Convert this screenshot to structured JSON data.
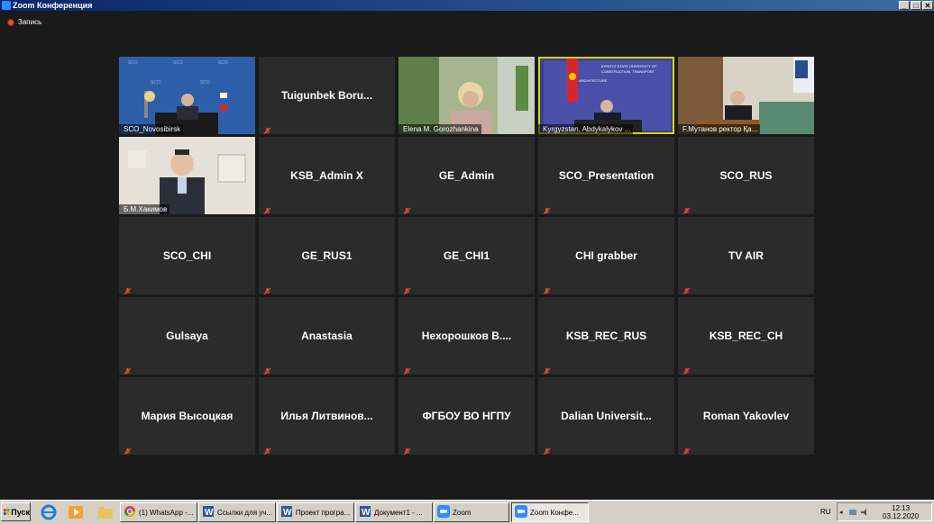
{
  "window": {
    "title": "Zoom Конференция",
    "minimize": "_",
    "maximize": "□",
    "close": "✕"
  },
  "recording": {
    "label": "Запись"
  },
  "tiles": [
    {
      "name": "SCO_Novosibirsk",
      "video": true,
      "kind": "novosibirsk"
    },
    {
      "name": "Tuigunbek Boru...",
      "video": false
    },
    {
      "name": "Elena M. Gorozhankina",
      "video": true,
      "kind": "elena"
    },
    {
      "name": "Kyrgyzstan, Abdykalykov ...",
      "video": true,
      "kind": "kyrgyz",
      "active": true
    },
    {
      "name": "F.Мутанов ректор Қа...",
      "video": true,
      "kind": "mutanov"
    },
    {
      "name": "Б.М.Хакимов",
      "video": true,
      "kind": "hakimov"
    },
    {
      "name": "KSB_Admin X",
      "video": false
    },
    {
      "name": "GE_Admin",
      "video": false
    },
    {
      "name": "SCO_Presentation",
      "video": false
    },
    {
      "name": "SCO_RUS",
      "video": false
    },
    {
      "name": "SCO_CHI",
      "video": false
    },
    {
      "name": "GE_RUS1",
      "video": false
    },
    {
      "name": "GE_CHI1",
      "video": false
    },
    {
      "name": "CHI grabber",
      "video": false
    },
    {
      "name": "TV AIR",
      "video": false
    },
    {
      "name": "Gulsaya",
      "video": false
    },
    {
      "name": "Anastasia",
      "video": false
    },
    {
      "name": "Нехорошков В....",
      "video": false
    },
    {
      "name": "KSB_REC_RUS",
      "video": false
    },
    {
      "name": "KSB_REC_CH",
      "video": false
    },
    {
      "name": "Мария Высоцкая",
      "video": false
    },
    {
      "name": "Илья Литвинов...",
      "video": false
    },
    {
      "name": "ФГБОУ ВО НГПУ",
      "video": false
    },
    {
      "name": "Dalian Universit...",
      "video": false
    },
    {
      "name": "Roman Yakovlev",
      "video": false
    }
  ],
  "taskbar": {
    "start_label": "Пуск",
    "items": [
      {
        "label": "(1) WhatsApp -...",
        "icon": "chrome-icon",
        "pressed": false
      },
      {
        "label": "Ссылки для уч...",
        "icon": "word-icon",
        "pressed": false
      },
      {
        "label": "Проект програ...",
        "icon": "word-icon",
        "pressed": false
      },
      {
        "label": "Документ1 - ...",
        "icon": "word-icon",
        "pressed": false
      },
      {
        "label": "Zoom",
        "icon": "zoom-icon",
        "pressed": false
      },
      {
        "label": "Zoom Конфе...",
        "icon": "zoom-icon",
        "pressed": true
      }
    ],
    "language": "RU",
    "time": "12:13",
    "date": "03.12.2020"
  },
  "colors": {
    "tile_bg": "#2b2b2b",
    "active_outline": "#d6d600",
    "mic_muted": "#e24b3b",
    "zoom_blue": "#2d8cff"
  }
}
